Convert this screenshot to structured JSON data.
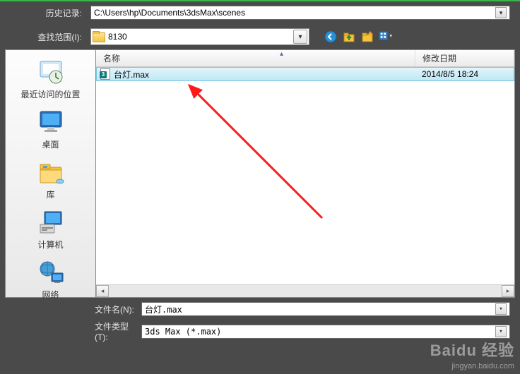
{
  "history": {
    "label": "历史记录:",
    "value": "C:\\Users\\hp\\Documents\\3dsMax\\scenes"
  },
  "lookin": {
    "label": "查找范围(I):",
    "value": "8130"
  },
  "sidebar": {
    "items": [
      {
        "label": "最近访问的位置"
      },
      {
        "label": "桌面"
      },
      {
        "label": "库"
      },
      {
        "label": "计算机"
      },
      {
        "label": "网络"
      }
    ]
  },
  "filelist": {
    "columns": {
      "name": "名称",
      "date": "修改日期"
    },
    "rows": [
      {
        "name": "台灯.max",
        "date": "2014/8/5 18:24"
      }
    ]
  },
  "filename": {
    "label": "文件名(N):",
    "value": "台灯.max"
  },
  "filetype": {
    "label": "文件类型(T):",
    "value": "3ds Max (*.max)"
  },
  "watermark": {
    "brand": "Baidu 经验",
    "url": "jingyan.baidu.com"
  }
}
